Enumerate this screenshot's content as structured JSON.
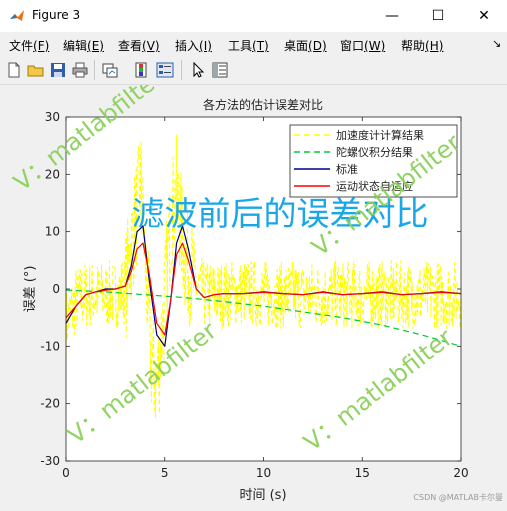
{
  "window": {
    "title": "Figure 3",
    "minimize_glyph": "—",
    "maximize_glyph": "☐",
    "close_glyph": "✕"
  },
  "menu": {
    "items": [
      {
        "text": "文件",
        "key": "(F)"
      },
      {
        "text": "编辑",
        "key": "(E)"
      },
      {
        "text": "查看",
        "key": "(V)"
      },
      {
        "text": "插入",
        "key": "(I)"
      },
      {
        "text": "工具",
        "key": "(T)"
      },
      {
        "text": "桌面",
        "key": "(D)"
      },
      {
        "text": "窗口",
        "key": "(W)"
      },
      {
        "text": "帮助",
        "key": "(H)"
      }
    ],
    "overflow_glyph": "↘"
  },
  "toolbar": {
    "icons": [
      "new-file-icon",
      "open-folder-icon",
      "save-icon",
      "print-icon",
      "link-plot-icon",
      "colorbar-icon",
      "legend-icon",
      "pointer-icon",
      "property-inspector-icon"
    ]
  },
  "overlay": {
    "banner": "滤波前后的误差对比",
    "watermark": "V：matlabfilter",
    "credit": "CSDN @MATLAB卡尔曼"
  },
  "colors": {
    "accel": "#ffff00",
    "gyro": "#00cc33",
    "reference": "#000080",
    "adaptive": "#ff0000",
    "banner": "#1aa7e8",
    "watermark": "#8cd15a"
  },
  "chart_data": {
    "type": "line",
    "title": "各方法的估计误差对比",
    "xlabel": "时间 (s)",
    "ylabel": "误差 (°)",
    "xlim": [
      0,
      20
    ],
    "ylim": [
      -30,
      30
    ],
    "xticks": [
      "0",
      "5",
      "10",
      "15",
      "20"
    ],
    "yticks": [
      "30",
      "20",
      "10",
      "0",
      "-10",
      "-20",
      "-30"
    ],
    "legend_position": "top-right",
    "grid": false,
    "series": [
      {
        "name": "加速度计计算结果",
        "style": "dashed",
        "x": [
          0,
          0.5,
          1,
          1.5,
          2,
          2.5,
          3,
          3.5,
          3.8,
          4,
          4.3,
          4.6,
          5,
          5.3,
          5.6,
          6,
          6.5,
          7,
          8,
          9,
          10,
          11,
          12,
          13,
          14,
          15,
          16,
          17,
          18,
          19,
          20
        ],
        "y": [
          -6,
          -2,
          -1,
          -1,
          -1,
          -1,
          0,
          12,
          18,
          6,
          -12,
          -17,
          -2,
          12,
          17,
          6,
          1,
          -1,
          -1,
          -0.5,
          -1,
          -1,
          -1,
          -1,
          -1,
          -1,
          -1,
          -1,
          -1,
          -1,
          -1
        ]
      },
      {
        "name": "陀螺仪积分结果",
        "style": "dashed",
        "x": [
          0,
          2,
          4,
          6,
          8,
          10,
          12,
          14,
          16,
          18,
          20
        ],
        "y": [
          -0.2,
          -0.5,
          -1,
          -1.5,
          -2.2,
          -3,
          -4,
          -5,
          -6.3,
          -8,
          -10
        ]
      },
      {
        "name": "标准",
        "style": "solid",
        "x": [
          0,
          0.5,
          1,
          1.5,
          2,
          2.5,
          3,
          3.3,
          3.6,
          3.9,
          4.2,
          4.6,
          5,
          5.3,
          5.6,
          5.9,
          6.2,
          6.6,
          7,
          7.5,
          8,
          9,
          10,
          11,
          12,
          13,
          14,
          15,
          16,
          17,
          18,
          19,
          20
        ],
        "y": [
          -6,
          -3,
          -1,
          -0.5,
          0,
          0,
          0.5,
          4,
          10,
          11,
          2,
          -8,
          -10,
          -2,
          8,
          11,
          7,
          0,
          -1.5,
          -1,
          -0.8,
          -0.8,
          -0.5,
          -0.8,
          -1,
          -0.5,
          -1,
          -0.8,
          -0.5,
          -1,
          -0.8,
          -0.5,
          -0.8
        ]
      },
      {
        "name": "运动状态自适应",
        "style": "solid",
        "x": [
          0,
          0.5,
          1,
          1.5,
          2,
          2.5,
          3,
          3.3,
          3.6,
          3.9,
          4.2,
          4.6,
          5,
          5.3,
          5.6,
          5.9,
          6.2,
          6.6,
          7,
          7.5,
          8,
          9,
          10,
          11,
          12,
          13,
          14,
          15,
          16,
          17,
          18,
          19,
          20
        ],
        "y": [
          -5,
          -3,
          -1,
          -0.5,
          -0.2,
          0,
          0.5,
          3,
          7,
          8,
          3,
          -6,
          -8,
          -2,
          6,
          8,
          5,
          0,
          -1.5,
          -1,
          -0.8,
          -0.8,
          -0.6,
          -0.8,
          -1,
          -0.6,
          -1,
          -0.8,
          -0.6,
          -1,
          -0.8,
          -0.6,
          -0.8
        ]
      }
    ]
  }
}
